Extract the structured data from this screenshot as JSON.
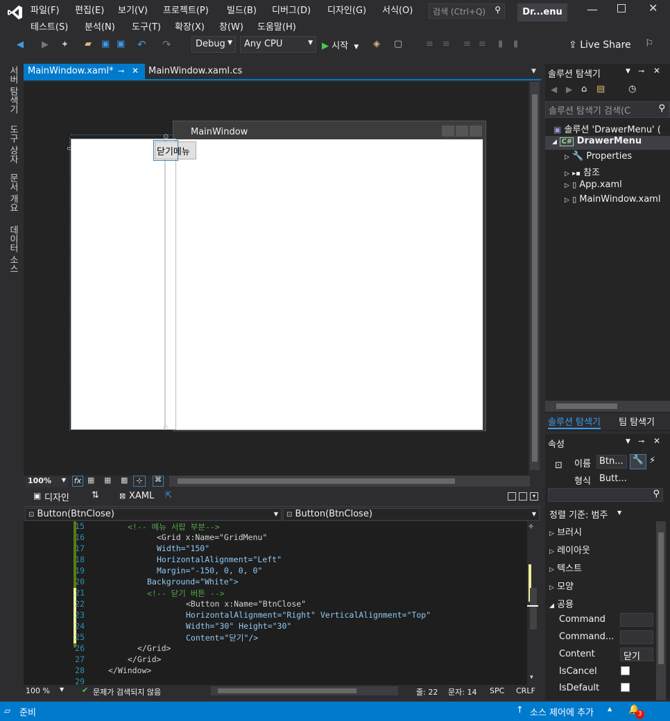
{
  "menu": {
    "items": [
      "파일(F)",
      "편집(E)",
      "보기(V)",
      "프로젝트(P)",
      "빌드(B)",
      "디버그(D)",
      "디자인(G)",
      "서식(O)",
      "테스트(S)",
      "분석(N)",
      "도구(T)",
      "확장(X)",
      "창(W)",
      "도움말(H)"
    ],
    "search_placeholder": "검색 (Ctrl+Q)",
    "solution_badge": "Dr...enu"
  },
  "toolbar": {
    "config": "Debug",
    "platform": "Any CPU",
    "start_label": "시작",
    "live_share": "Live Share"
  },
  "left_tabs": [
    "서버 탐색기",
    "도구 상자",
    "문서 개요",
    "데이터 소스"
  ],
  "doc_tabs": {
    "active": "MainWindow.xaml*",
    "inactive": "MainWindow.xaml.cs"
  },
  "designer": {
    "window_title": "MainWindow",
    "button_content": "닫기",
    "menu_text": "메뉴",
    "zoom": "100%",
    "design_tab": "디자인",
    "xaml_tab": "XAML"
  },
  "editor": {
    "nav_left": "Button(BtnClose)",
    "nav_right": "Button(BtnClose)",
    "lines": [
      {
        "n": "15",
        "text": "<!-- 메뉴 서랍 부분-->",
        "kind": "com",
        "indent": 0
      },
      {
        "n": "16",
        "text": "<Grid x:Name=\"GridMenu\"",
        "kind": "tag",
        "indent": 0
      },
      {
        "n": "17",
        "text": "Width=\"150\"",
        "kind": "attr",
        "indent": 1
      },
      {
        "n": "18",
        "text": "HorizontalAlignment=\"Left\"",
        "kind": "attr",
        "indent": 1
      },
      {
        "n": "19",
        "text": "Margin=\"-150, 0, 0, 0\"",
        "kind": "attr",
        "indent": 1
      },
      {
        "n": "20",
        "text": "Background=\"White\">",
        "kind": "attr",
        "indent": 1
      },
      {
        "n": "21",
        "text": "<!-- 닫기 버튼 -->",
        "kind": "com",
        "indent": 2
      },
      {
        "n": "22",
        "text": "<Button x:Name=\"BtnClose\"",
        "kind": "tag",
        "indent": 2
      },
      {
        "n": "23",
        "text": "HorizontalAlignment=\"Right\" VerticalAlignment=\"Top\"",
        "kind": "attr",
        "indent": 3
      },
      {
        "n": "24",
        "text": "Width=\"30\" Height=\"30\"",
        "kind": "attr",
        "indent": 3
      },
      {
        "n": "25",
        "text": "Content=\"닫기\"/>",
        "kind": "attr",
        "indent": 3
      },
      {
        "n": "26",
        "text": "</Grid>",
        "kind": "tag",
        "indent": 4
      },
      {
        "n": "27",
        "text": "</Grid>",
        "kind": "tag",
        "indent": 5
      },
      {
        "n": "28",
        "text": "</Window>",
        "kind": "tag",
        "indent": 6
      },
      {
        "n": "29",
        "text": "",
        "kind": "tag",
        "indent": 0
      }
    ],
    "zoom": "100 %",
    "issues": "문제가 검색되지 않음",
    "line": "줄: 22",
    "col": "문자: 14",
    "spc": "SPC",
    "crlf": "CRLF"
  },
  "solution_explorer": {
    "title": "솔루션 탐색기",
    "search_placeholder": "솔루션 탐색기 검색(C",
    "solution": "솔루션 'DrawerMenu' (",
    "project": "DrawerMenu",
    "items": [
      "Properties",
      "참조",
      "App.xaml",
      "MainWindow.xaml"
    ],
    "tab_solution": "솔루션 탐색기",
    "tab_team": "팀 탐색기"
  },
  "properties": {
    "title": "속성",
    "name_label": "이름",
    "name_value": "Btn...",
    "type_label": "형식",
    "type_value": "Butt...",
    "sort_label": "정렬 기준: 범주",
    "categories": [
      "브러시",
      "레이아웃",
      "텍스트",
      "모양",
      "공용"
    ],
    "rows": [
      {
        "label": "Command",
        "value": ""
      },
      {
        "label": "Command...",
        "value": ""
      },
      {
        "label": "Content",
        "value": "닫기"
      }
    ],
    "checks": [
      "IsCancel",
      "IsDefault"
    ]
  },
  "status": {
    "ready": "준비",
    "source_control": "소스 제어에 추가",
    "notification_count": "3"
  }
}
